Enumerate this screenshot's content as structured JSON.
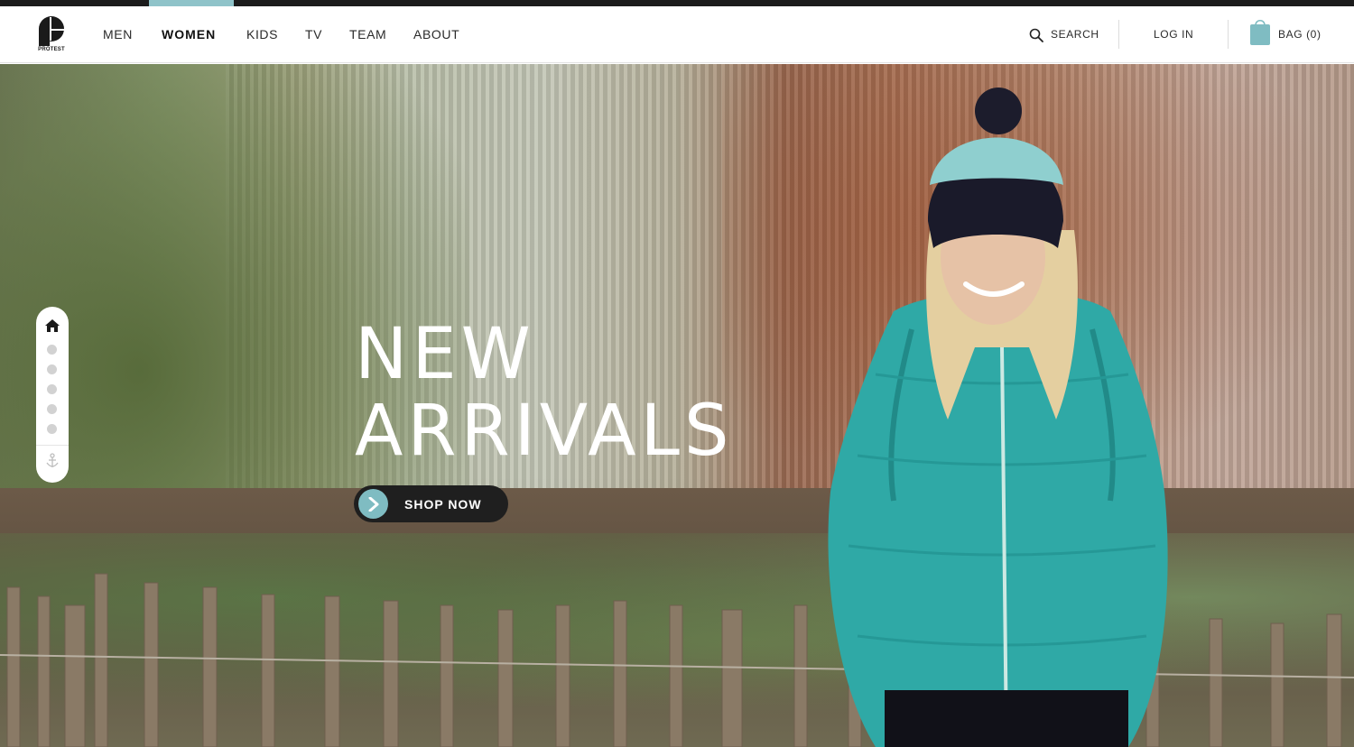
{
  "brand": {
    "logo_text": "PROTEST",
    "accent_color": "#8fc3c9",
    "dark_color": "#1c1c1c"
  },
  "nav": {
    "items": [
      {
        "label": "MEN",
        "active": false
      },
      {
        "label": "WOMEN",
        "active": true
      },
      {
        "label": "KIDS",
        "active": false
      },
      {
        "label": "TV",
        "active": false
      },
      {
        "label": "TEAM",
        "active": false
      },
      {
        "label": "ABOUT",
        "active": false
      }
    ]
  },
  "utility": {
    "search_label": "SEARCH",
    "search_icon": "search-icon",
    "login_label": "LOG IN",
    "bag_label": "BAG (0)",
    "bag_icon": "shopping-bag-icon"
  },
  "hero": {
    "headline_line1": "NEW",
    "headline_line2": "ARRIVALS",
    "cta_label": "SHOP NOW",
    "cta_icon": "chevron-right-icon"
  },
  "side_nav": {
    "home_icon": "home-icon",
    "dot_count_label": "5",
    "anchor_icon": "anchor-icon"
  }
}
